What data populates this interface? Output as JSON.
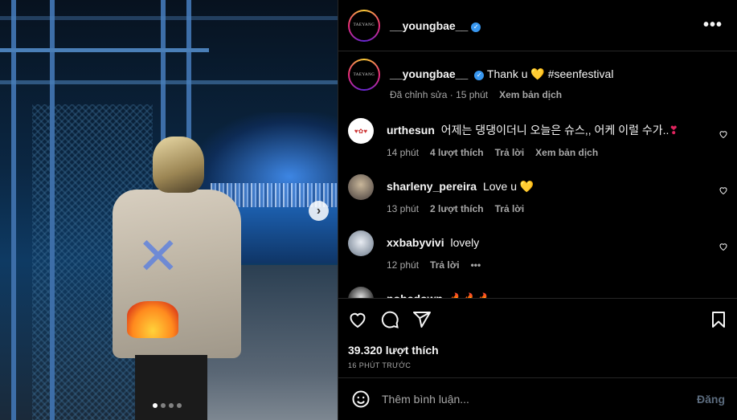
{
  "post": {
    "author": "__youngbae__",
    "avatar_text": "TAEYANG",
    "caption_text": "Thank u",
    "caption_emoji": "💛",
    "caption_tag": "#seenfestival",
    "caption_edited": "Đã chỉnh sửa · 15 phút",
    "caption_translate": "Xem bản dịch",
    "carousel": {
      "count": 4,
      "active": 1
    }
  },
  "comments": [
    {
      "user": "urthesun",
      "text": "어제는 댕댕이더니 오늘은 슈스,, 어케 이럴 수가..",
      "emoji": "❣",
      "time": "14 phút",
      "likes": "4 lượt thích",
      "reply": "Trả lời",
      "translate": "Xem bản dịch"
    },
    {
      "user": "sharleny_pereira",
      "text": "Love u",
      "emoji": "💛",
      "time": "13 phút",
      "likes": "2 lượt thích",
      "reply": "Trả lời"
    },
    {
      "user": "xxbabyvivi",
      "text": "lovely",
      "time": "12 phút",
      "reply": "Trả lời",
      "more": "•••"
    },
    {
      "user": "nohcdown",
      "text": "🔥🔥🔥"
    }
  ],
  "stats": {
    "likes": "39.320 lượt thích",
    "time_ago": "16 PHÚT TRƯỚC"
  },
  "composer": {
    "placeholder": "Thêm bình luận...",
    "post_label": "Đăng"
  },
  "colors": {
    "background": "#000000",
    "secondary_text": "#a8a8a8",
    "verified": "#3897f0",
    "post_disabled": "#5b6b7d"
  }
}
